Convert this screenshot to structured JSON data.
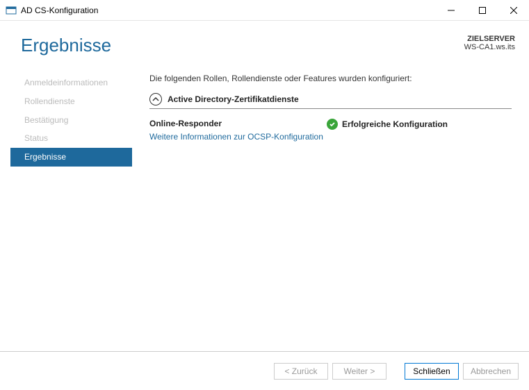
{
  "window": {
    "title": "AD CS-Konfiguration"
  },
  "header": {
    "page_title": "Ergebnisse",
    "target_label": "ZIELSERVER",
    "target_name": "WS-CA1.ws.its"
  },
  "sidebar": {
    "items": [
      {
        "label": "Anmeldeinformationen",
        "active": false
      },
      {
        "label": "Rollendienste",
        "active": false
      },
      {
        "label": "Bestätigung",
        "active": false
      },
      {
        "label": "Status",
        "active": false
      },
      {
        "label": "Ergebnisse",
        "active": true
      }
    ]
  },
  "content": {
    "intro": "Die folgenden Rollen, Rollendienste oder Features wurden konfiguriert:",
    "section_title": "Active Directory-Zertifikatdienste",
    "role_name": "Online-Responder",
    "more_info_link": "Weitere Informationen zur OCSP-Konfiguration",
    "status_text": "Erfolgreiche Konfiguration"
  },
  "footer": {
    "back": "< Zurück",
    "next": "Weiter >",
    "close": "Schließen",
    "cancel": "Abbrechen"
  }
}
